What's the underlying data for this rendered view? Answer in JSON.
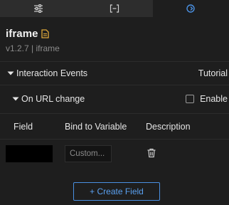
{
  "tabs": [
    {
      "icon": "sliders-icon",
      "active": false
    },
    {
      "icon": "bracket-code-icon",
      "active": false
    },
    {
      "icon": "interaction-icon",
      "active": true
    }
  ],
  "component": {
    "title": "iframe",
    "doc_icon": "document-icon",
    "subtitle": "v1.2.7 | iframe"
  },
  "interactions": {
    "section_label": "Interaction Events",
    "tutorial_label": "Tutorial",
    "event": {
      "label": "On URL change",
      "enable_label": "Enable",
      "enabled": false
    },
    "table": {
      "headers": [
        "Field",
        "Bind to Variable",
        "Description"
      ],
      "rows": [
        {
          "field": "",
          "bind_placeholder": "Custom...",
          "bind_value": ""
        }
      ]
    },
    "create_field_label": "+ Create Field"
  },
  "colors": {
    "background": "#1e1e1e",
    "tab_inactive": "#2d2d2d",
    "accent": "#4a90e2",
    "doc_icon": "#e0a83a",
    "muted_text": "#8a8a8a"
  }
}
